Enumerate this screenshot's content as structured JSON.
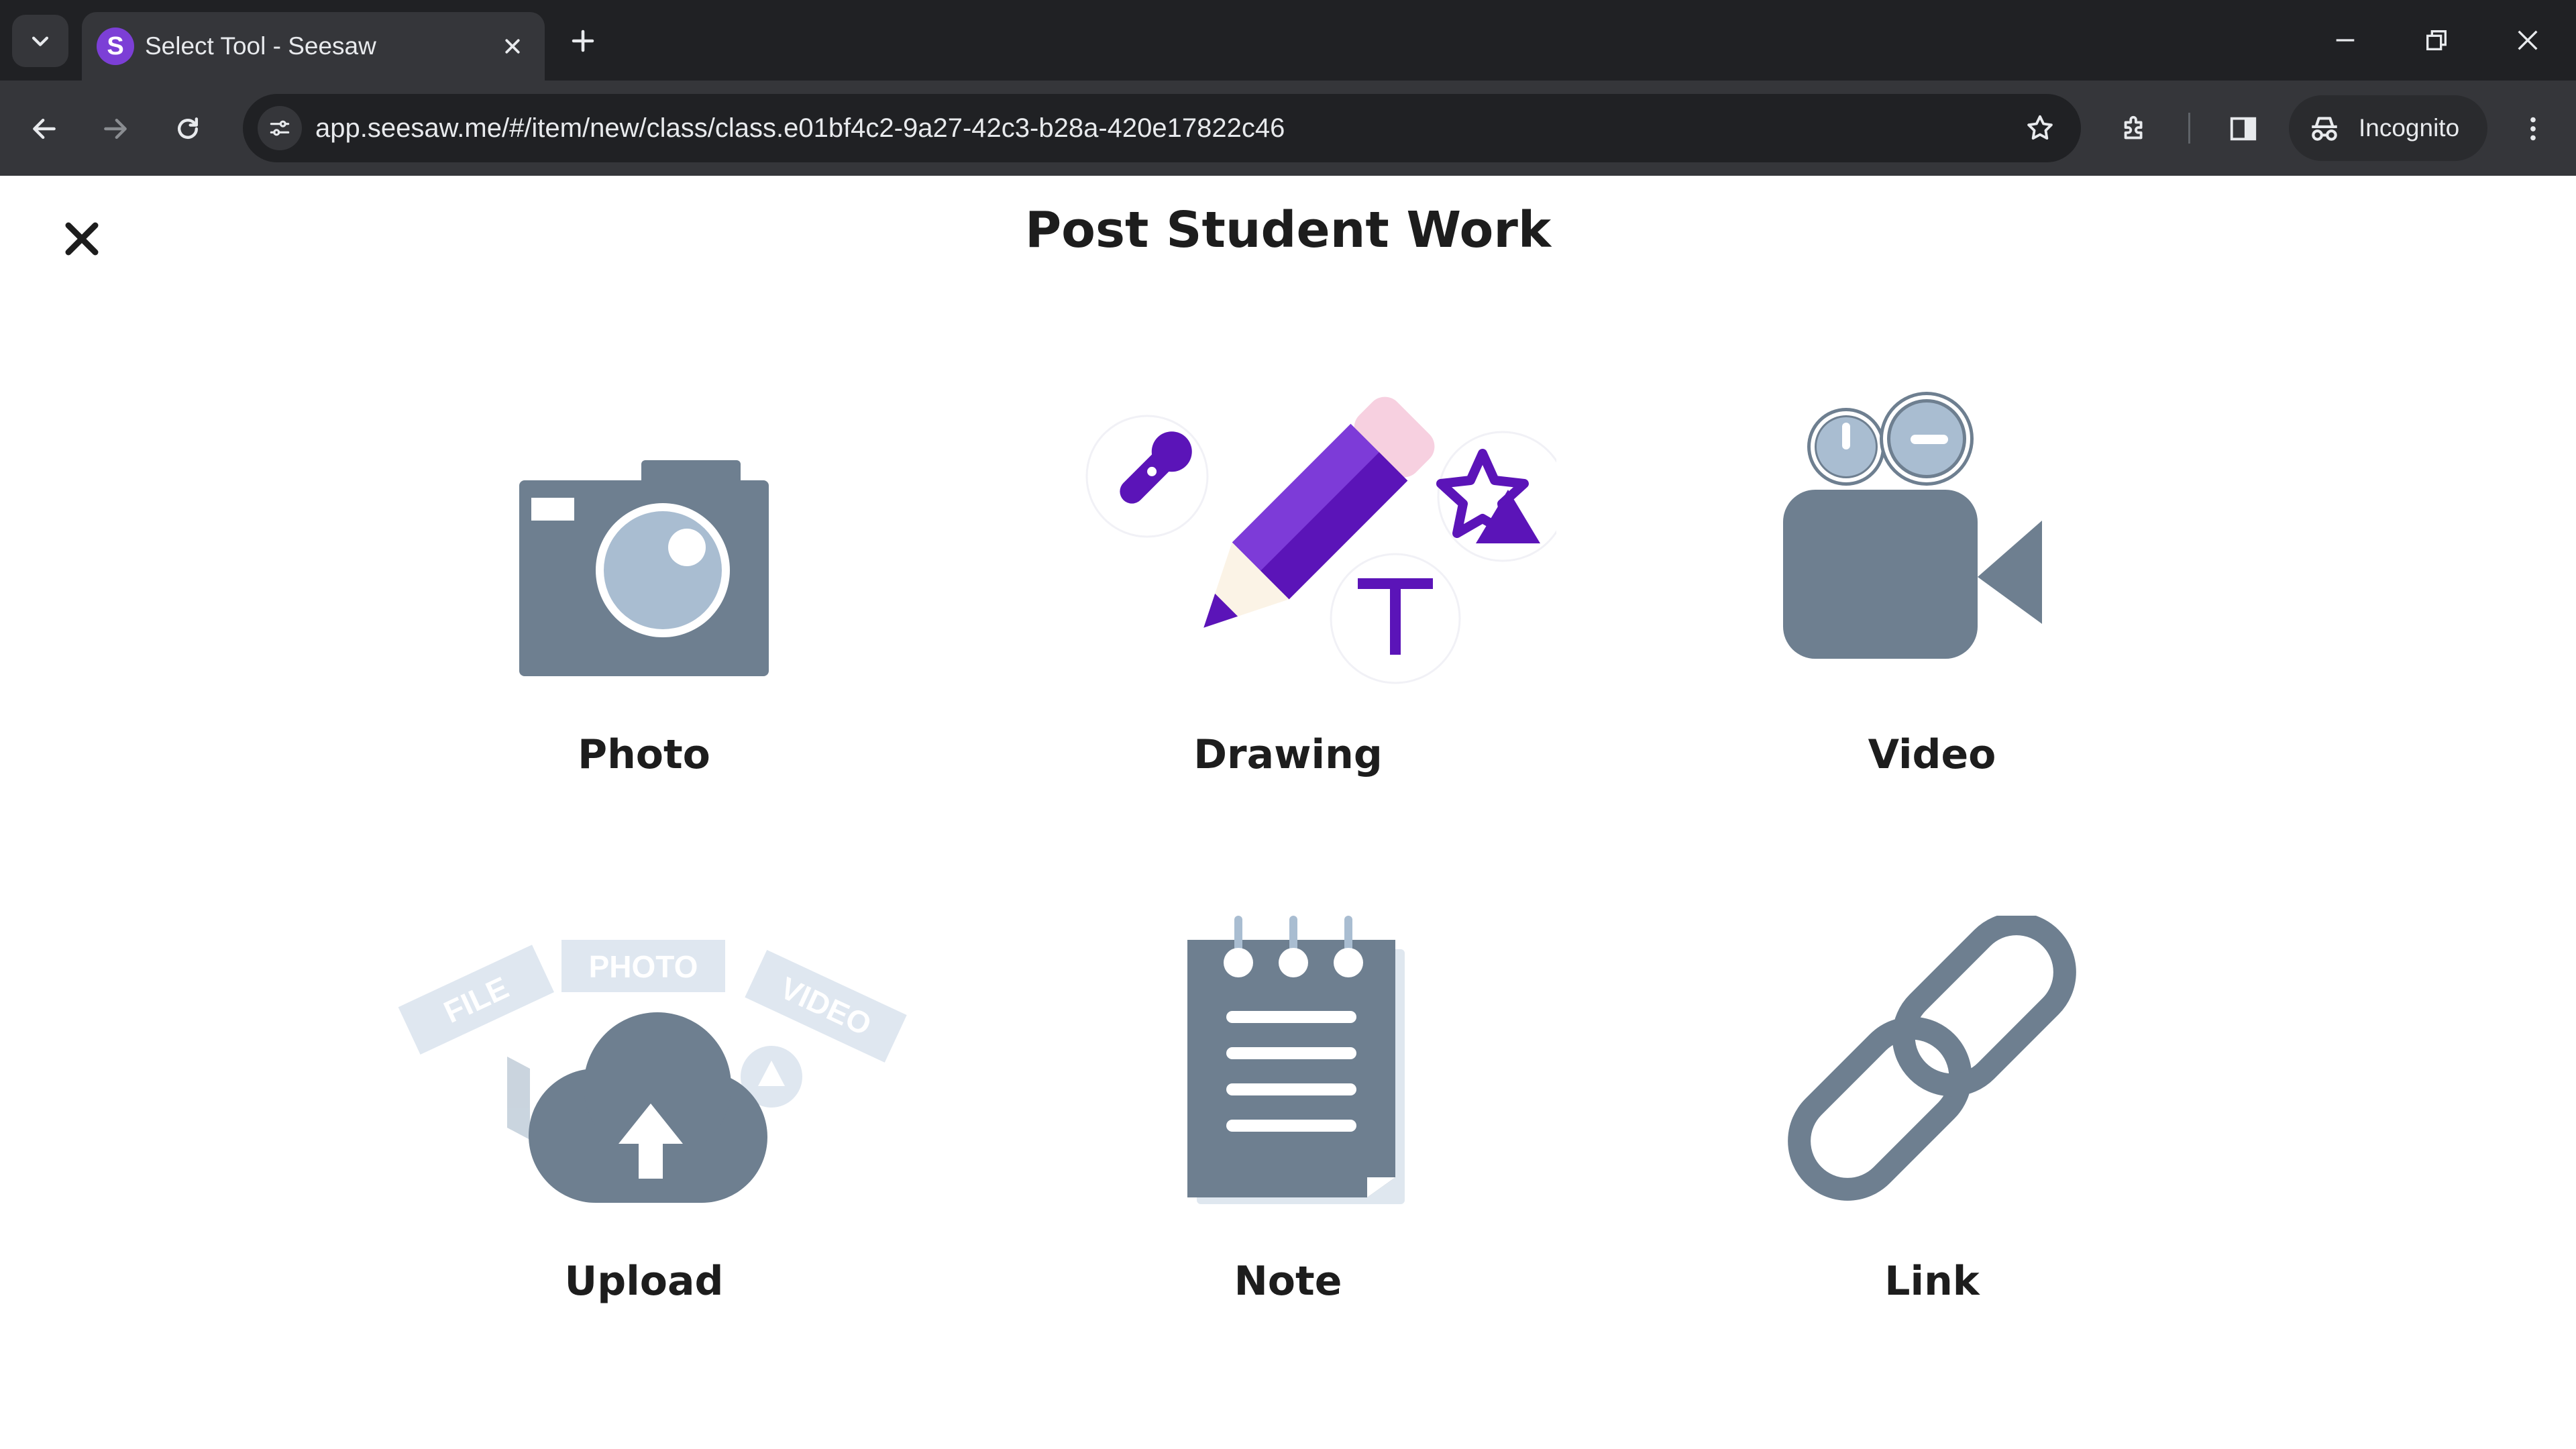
{
  "browser": {
    "tab_title": "Select Tool - Seesaw",
    "favicon_letter": "S",
    "url": "app.seesaw.me/#/item/new/class/class.e01bf4c2-9a27-42c3-b28a-420e17822c46",
    "incognito_label": "Incognito"
  },
  "page": {
    "title": "Post Student Work"
  },
  "tools": [
    {
      "label": "Photo",
      "icon": "camera-icon"
    },
    {
      "label": "Drawing",
      "icon": "drawing-pencil-icon"
    },
    {
      "label": "Video",
      "icon": "video-camera-icon"
    },
    {
      "label": "Upload",
      "icon": "cloud-upload-icon"
    },
    {
      "label": "Note",
      "icon": "notepad-icon"
    },
    {
      "label": "Link",
      "icon": "chain-link-icon"
    }
  ],
  "upload_art_labels": {
    "file": "FILE",
    "photo": "PHOTO",
    "video": "VIDEO"
  },
  "drawing_art_letter": "T",
  "colors": {
    "icon_gray": "#6e7f90",
    "icon_light": "#a9bdd1",
    "drawing_purple": "#5b14b8",
    "drawing_purple_light": "#7d3bd8",
    "eraser_pink": "#f7d0e0"
  }
}
